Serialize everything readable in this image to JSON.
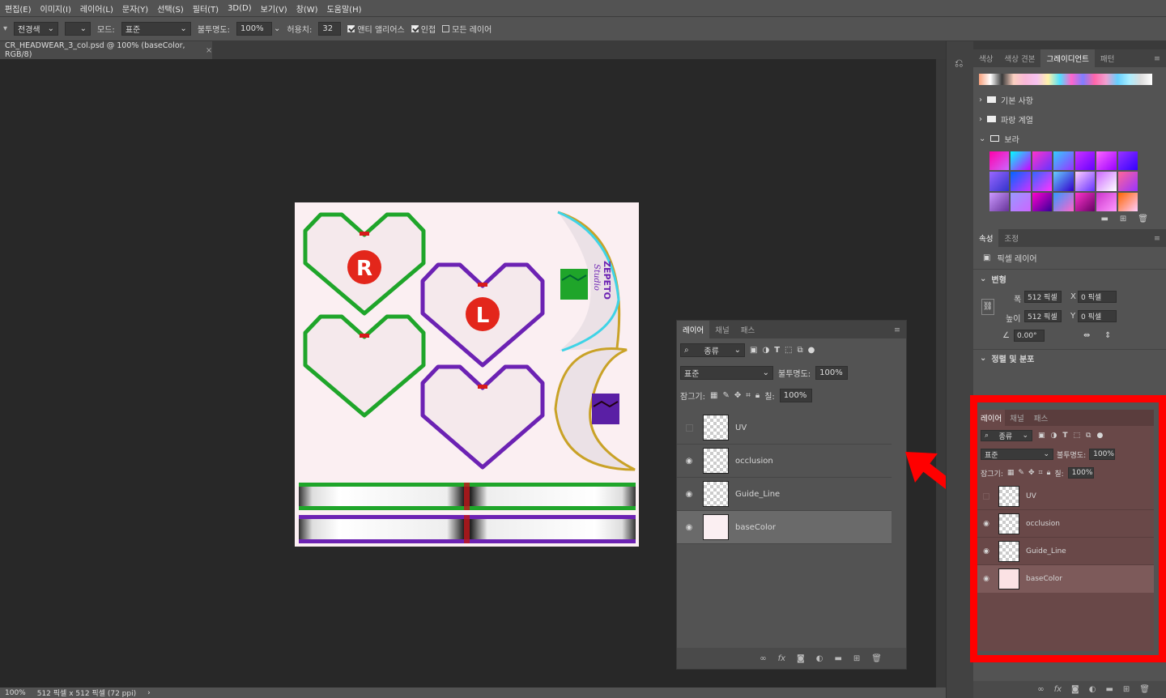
{
  "menu": [
    "편집(E)",
    "이미지(I)",
    "레이어(L)",
    "문자(Y)",
    "선택(S)",
    "필터(T)",
    "3D(D)",
    "보기(V)",
    "창(W)",
    "도움말(H)"
  ],
  "options": {
    "fill_source": "전경색",
    "mode_label": "모드:",
    "mode_value": "표준",
    "opacity_label": "불투명도:",
    "opacity_value": "100%",
    "tolerance_label": "허용치:",
    "tolerance_value": "32",
    "antialias": "앤티 앨리어스",
    "contiguous": "인접",
    "all_layers": "모든 레이어"
  },
  "document": {
    "tab_title": "CR_HEADWEAR_3_col.psd @ 100% (baseColor, RGB/8)",
    "zoom": "100%",
    "size_info": "512 픽셀 x 512 픽셀 (72 ppi)"
  },
  "artwork": {
    "letter_r": "R",
    "letter_l": "L",
    "logo_line1": "ZEPETO",
    "logo_line2": "Studio"
  },
  "swatch_panel": {
    "tabs": [
      "색상",
      "색상 견본",
      "그레이디언트",
      "패턴"
    ],
    "active_tab": "그레이디언트",
    "folders": [
      "기본 사항",
      "파랑 계열",
      "보라"
    ]
  },
  "properties": {
    "tabs": [
      "속성",
      "조정"
    ],
    "layer_type": "픽셀 레이어",
    "transform_title": "변형",
    "width_label": "폭",
    "width_value": "512 픽셀",
    "height_label": "높이",
    "height_value": "512 픽셀",
    "x_label": "X",
    "x_value": "0 픽셀",
    "y_label": "Y",
    "y_value": "0 픽셀",
    "angle_value": "0.00°",
    "align_title": "정렬 및 분포"
  },
  "layers_panel": {
    "tabs": [
      "레이어",
      "채널",
      "패스"
    ],
    "filter_kind": "종류",
    "blend_mode": "표준",
    "opacity_label": "불투명도:",
    "opacity_value": "100%",
    "lock_label": "잠그기:",
    "fill_label": "칠:",
    "fill_value": "100%",
    "layers": [
      {
        "name": "UV",
        "visible": false
      },
      {
        "name": "occlusion",
        "visible": true
      },
      {
        "name": "Guide_Line",
        "visible": true
      },
      {
        "name": "baseColor",
        "visible": true,
        "selected": true
      }
    ]
  },
  "colors": {
    "highlight_box": "#ff0000",
    "arrow": "#ff0000",
    "heart_green": "#1fa52a",
    "heart_purple": "#6c22b3",
    "badge_red": "#e3261b"
  }
}
